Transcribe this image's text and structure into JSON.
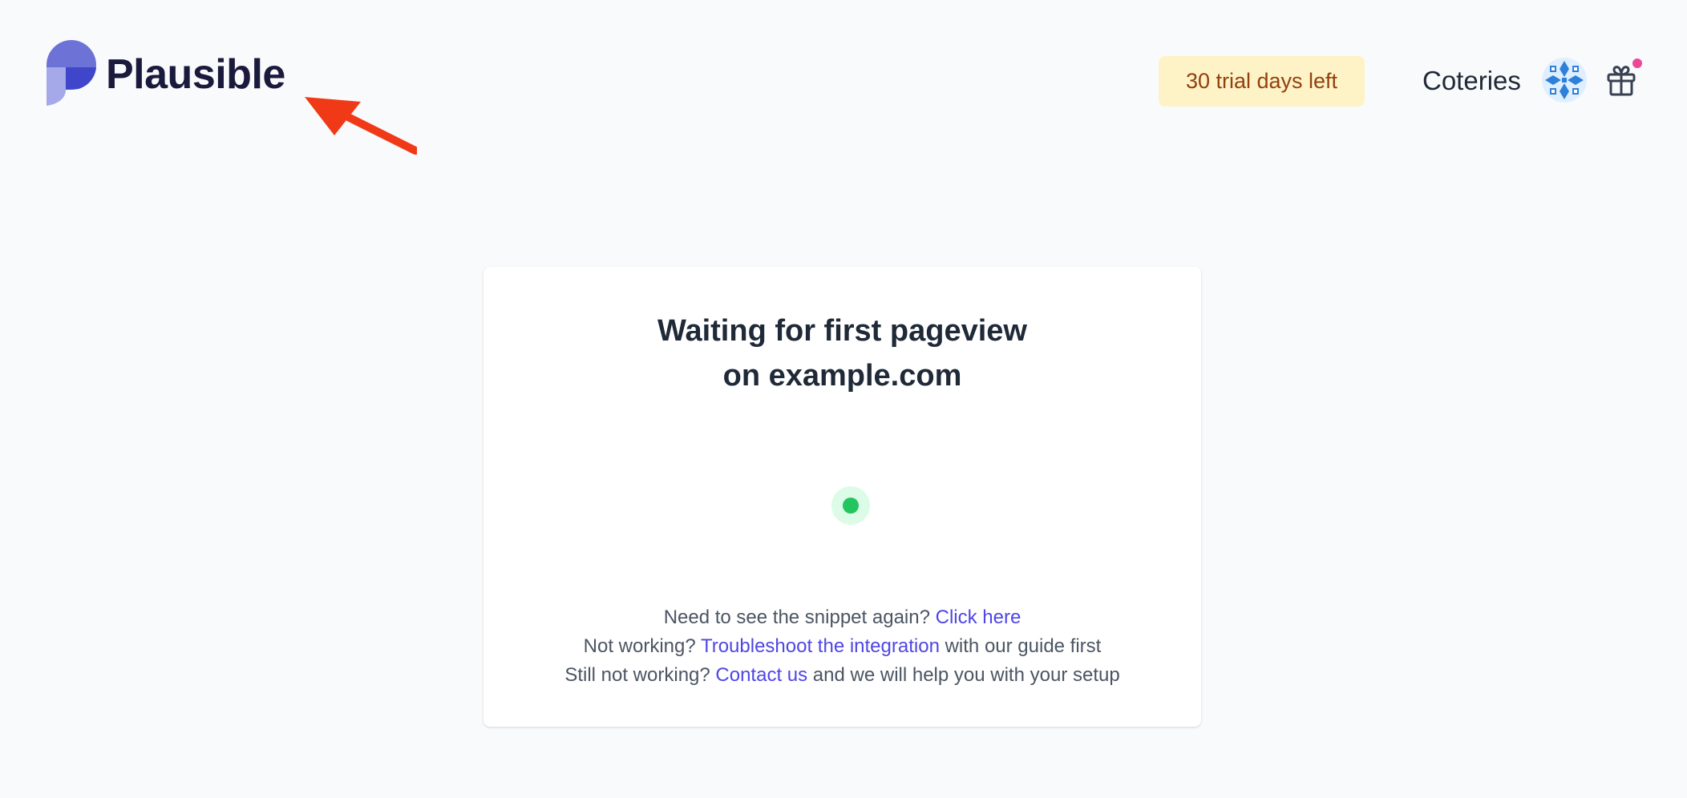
{
  "header": {
    "brand_name": "Plausible",
    "trial_badge": "30 trial days left",
    "site_name": "Coteries",
    "icons": {
      "logo": "plausible-logo-icon",
      "arrow": "red-arrow-annotation",
      "avatar": "user-avatar",
      "gift": "gift-icon"
    }
  },
  "card": {
    "title_line1": "Waiting for first pageview",
    "title_line2": "on example.com",
    "status": "pulse-indicator",
    "help": {
      "line1_prefix": "Need to see the snippet again? ",
      "line1_link": "Click here",
      "line2_prefix": "Not working? ",
      "line2_link": "Troubleshoot the integration",
      "line2_suffix": " with our guide first",
      "line3_prefix": "Still not working? ",
      "line3_link": "Contact us",
      "line3_suffix": " and we will help you with your setup"
    }
  },
  "colors": {
    "page_background": "#f9fafb",
    "brand_text": "#1a1a3d",
    "badge_bg": "#fef3c7",
    "badge_text": "#92400e",
    "link": "#4f46e5",
    "pulse_green": "#22c55e",
    "pulse_bg": "#dcfce7",
    "notification_dot": "#ec4899",
    "arrow_red": "#f03a17"
  }
}
